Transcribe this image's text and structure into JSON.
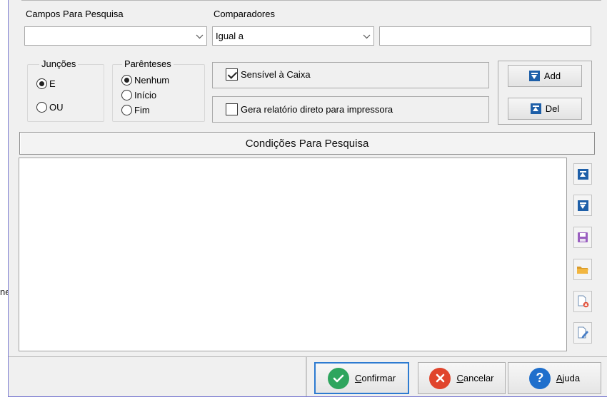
{
  "background": {
    "clipped_text": "ne"
  },
  "search_fields": {
    "label": "Campos Para Pesquisa",
    "value": ""
  },
  "comparators": {
    "label": "Comparadores",
    "value": "Igual a"
  },
  "compare_value": {
    "value": ""
  },
  "joins": {
    "title": "Junções",
    "options": [
      {
        "label": "E",
        "selected": true
      },
      {
        "label": "OU",
        "selected": false
      }
    ]
  },
  "parentheses": {
    "title": "Parênteses",
    "options": [
      {
        "label": "Nenhum",
        "selected": true
      },
      {
        "label": "Início",
        "selected": false
      },
      {
        "label": "Fim",
        "selected": false
      }
    ]
  },
  "options": {
    "case_sensitive": {
      "label": "Sensível à Caixa",
      "checked": true
    },
    "direct_print": {
      "label": "Gera relatório direto para impressora",
      "checked": false
    }
  },
  "buttons": {
    "add": "Add",
    "del": "Del"
  },
  "conditions": {
    "header": "Condições Para Pesquisa",
    "items": []
  },
  "side_toolbar": [
    "move-up-icon",
    "move-down-icon",
    "save-icon",
    "open-folder-icon",
    "delete-document-icon",
    "edit-document-icon"
  ],
  "footer": {
    "confirm": "Confirmar",
    "cancel": "Cancelar",
    "help": "Ajuda"
  },
  "colors": {
    "accent": "#1e5fa8",
    "confirm": "#2ea55e",
    "cancel": "#e0452d",
    "help": "#1f6fcc",
    "focus": "#2d7bd1"
  }
}
